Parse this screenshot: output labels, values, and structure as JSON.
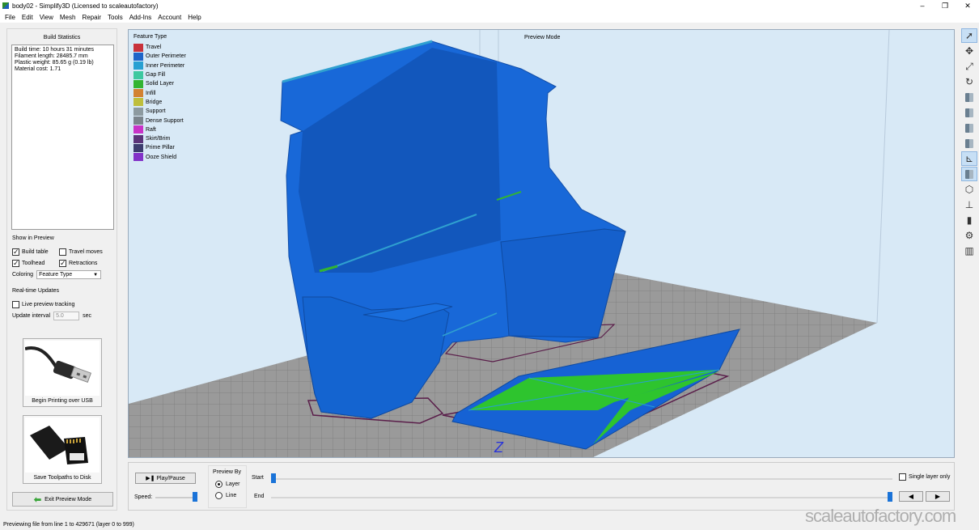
{
  "window": {
    "title": "body02 - Simplify3D (Licensed to scaleautofactory)",
    "controls": [
      "–",
      "❐",
      "✕"
    ]
  },
  "menu": [
    "File",
    "Edit",
    "View",
    "Mesh",
    "Repair",
    "Tools",
    "Add-Ins",
    "Account",
    "Help"
  ],
  "build_statistics": {
    "heading": "Build Statistics",
    "lines": [
      "Build time: 10 hours 31 minutes",
      "Filament length: 28485.7 mm",
      "Plastic weight: 85.65 g (0.19 lb)",
      "Material cost: 1.71"
    ]
  },
  "show_in_preview": {
    "label": "Show in Preview",
    "build_table": {
      "label": "Build table",
      "checked": true
    },
    "travel_moves": {
      "label": "Travel moves",
      "checked": false
    },
    "toolhead": {
      "label": "Toolhead",
      "checked": true
    },
    "retractions": {
      "label": "Retractions",
      "checked": true
    },
    "coloring_label": "Coloring",
    "coloring_value": "Feature Type"
  },
  "realtime_updates": {
    "label": "Real-time Updates",
    "live_tracking": {
      "label": "Live preview tracking",
      "checked": false
    },
    "interval_label": "Update interval",
    "interval_value": "5.0",
    "interval_unit": "sec"
  },
  "buttons": {
    "usb": "Begin Printing over USB",
    "sd": "Save Toolpaths to Disk",
    "exit": "Exit Preview Mode",
    "play": "Play/Pause"
  },
  "legend": {
    "title": "Feature Type",
    "items": [
      {
        "label": "Travel",
        "color": "#c8323c"
      },
      {
        "label": "Outer Perimeter",
        "color": "#1e64c8"
      },
      {
        "label": "Inner Perimeter",
        "color": "#28a0d2"
      },
      {
        "label": "Gap Fill",
        "color": "#3cc8a0"
      },
      {
        "label": "Solid Layer",
        "color": "#32b432"
      },
      {
        "label": "Infill",
        "color": "#d28232"
      },
      {
        "label": "Bridge",
        "color": "#bebe3c"
      },
      {
        "label": "Support",
        "color": "#8c9aa0"
      },
      {
        "label": "Dense Support",
        "color": "#7a848c"
      },
      {
        "label": "Raft",
        "color": "#c832c8"
      },
      {
        "label": "Skirt/Brim",
        "color": "#5a3278"
      },
      {
        "label": "Prime Pillar",
        "color": "#3c3c6e"
      },
      {
        "label": "Ooze Shield",
        "color": "#8232c8"
      }
    ]
  },
  "viewport": {
    "mode_label": "Preview Mode",
    "axis_label": "Z"
  },
  "preview_controls": {
    "speed_label": "Speed:",
    "speed_fraction": 1.0,
    "preview_by_label": "Preview By",
    "preview_by_options": [
      {
        "label": "Layer",
        "selected": true
      },
      {
        "label": "Line",
        "selected": false
      }
    ],
    "start_label": "Start",
    "end_label": "End",
    "start_fraction": 0.0,
    "end_fraction": 1.0,
    "single_layer": {
      "label": "Single layer only",
      "checked": false
    },
    "prev": "◀",
    "next": "▶"
  },
  "status": "Previewing file from line 1 to 429671 (layer 0 to 999)",
  "watermark": "scaleautofactory.com",
  "toolbar_icons": [
    "select-icon",
    "move-icon",
    "scale-icon",
    "rotate-icon",
    "view-default-icon",
    "view-front-icon",
    "view-top-icon",
    "view-side-icon",
    "axes-icon",
    "solid-view-icon",
    "wireframe-icon",
    "build-volume-icon",
    "cross-section-icon",
    "settings-icon",
    "bed-icon"
  ]
}
